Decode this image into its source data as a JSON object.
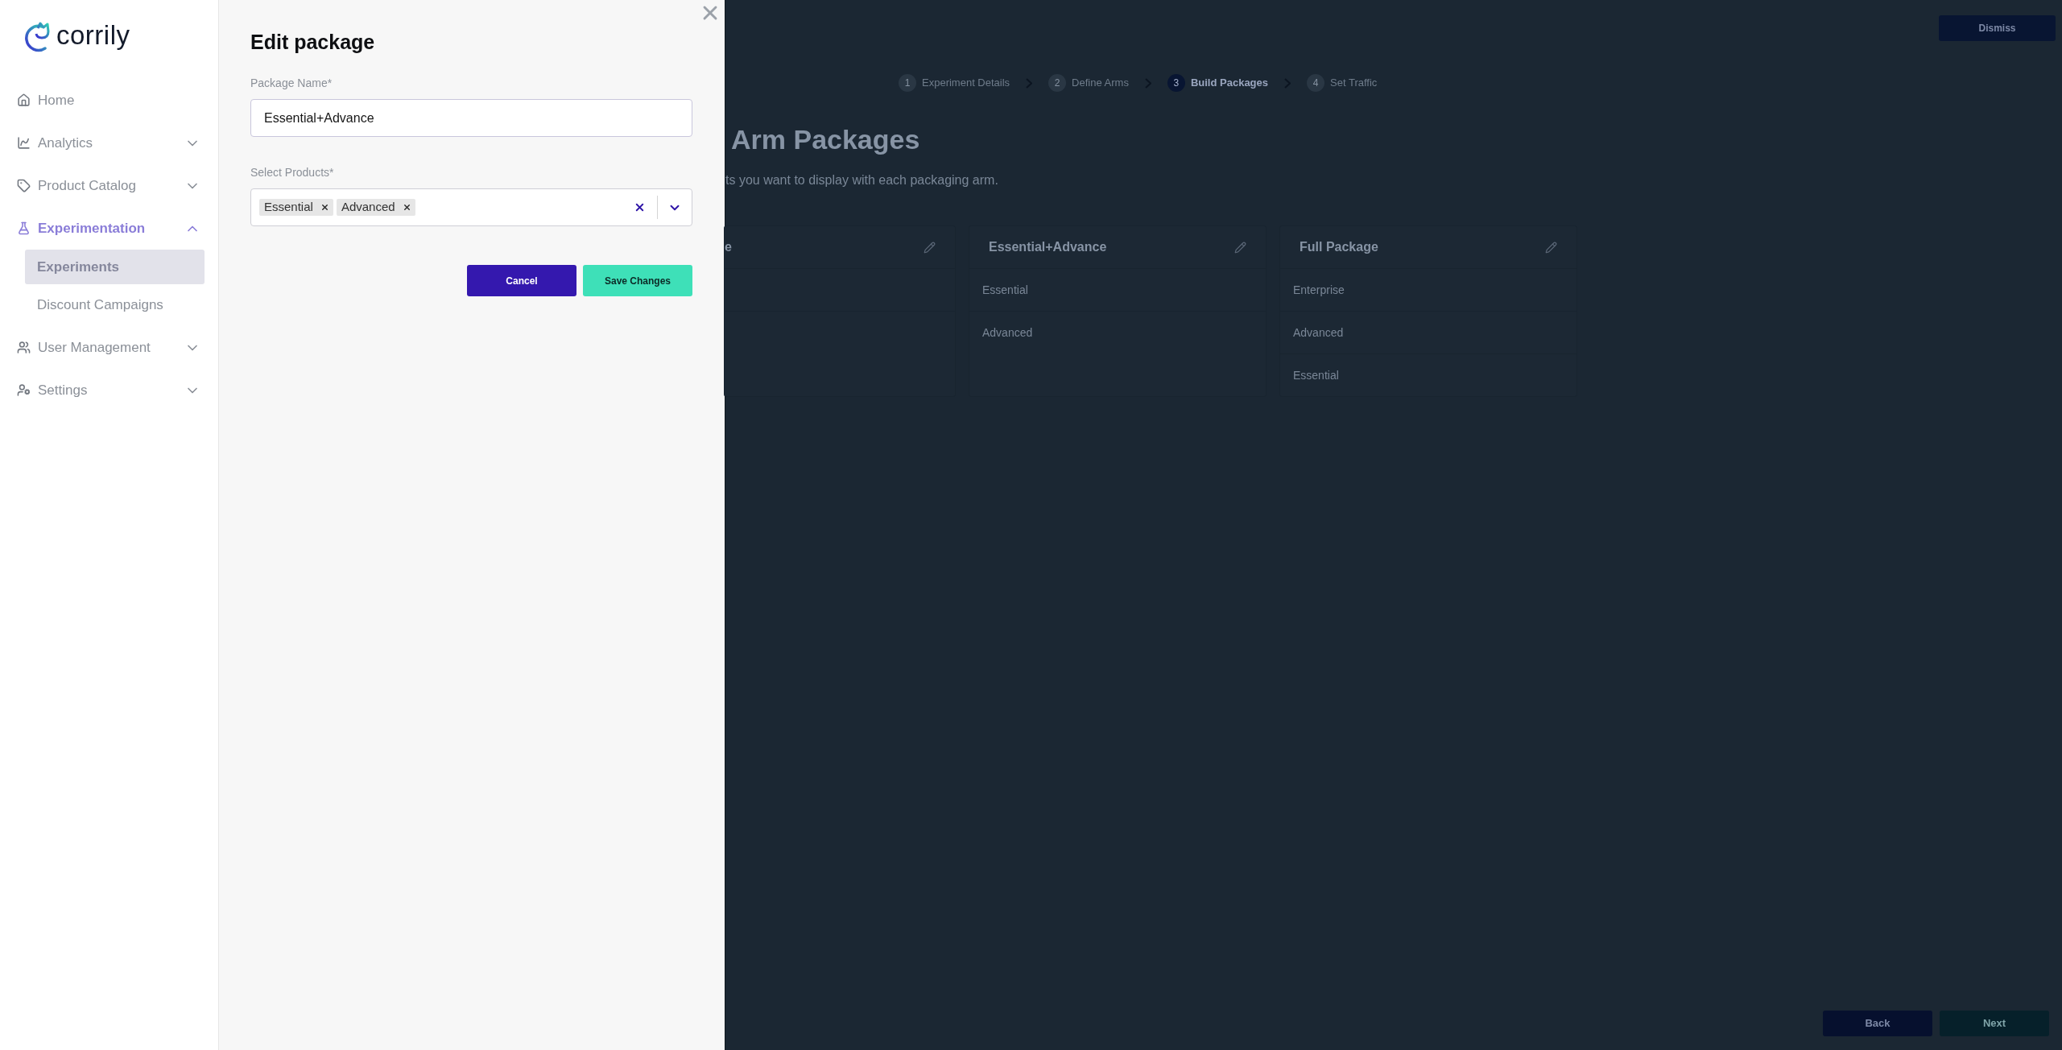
{
  "sidebar": {
    "logo": "corrily",
    "items": [
      {
        "label": "Home",
        "kind": "link",
        "selected": false
      },
      {
        "label": "Analytics",
        "kind": "group",
        "selected": false,
        "expanded": false
      },
      {
        "label": "Product Catalog",
        "kind": "group",
        "selected": false,
        "expanded": false
      },
      {
        "label": "Experimentation",
        "kind": "group",
        "selected": true,
        "expanded": true,
        "children": [
          {
            "label": "Experiments",
            "selected": true
          },
          {
            "label": "Discount Campaigns",
            "selected": false
          }
        ]
      },
      {
        "label": "User Management",
        "kind": "group",
        "selected": false,
        "expanded": false
      },
      {
        "label": "Settings",
        "kind": "group",
        "selected": false,
        "expanded": false
      }
    ]
  },
  "panel": {
    "title": "Edit package",
    "package_name": {
      "label": "Package Name*",
      "value": "Essential+Advance"
    },
    "products": {
      "label": "Select Products*",
      "tags": [
        "Essential",
        "Advanced"
      ]
    },
    "buttons": {
      "cancel": "Cancel",
      "save": "Save Changes"
    }
  },
  "page": {
    "dismiss": "Dismiss",
    "steps": [
      {
        "number": "1",
        "label": "Experiment Details",
        "selected": false
      },
      {
        "number": "2",
        "label": "Define Arms",
        "selected": false
      },
      {
        "number": "3",
        "label": "Build Packages",
        "selected": true
      },
      {
        "number": "4",
        "label": "Set Traffic",
        "selected": false
      }
    ],
    "title": "Arm Packages",
    "subtitle": "ts you want to display with each packaging arm.",
    "packages": [
      {
        "name": "e"
      },
      {
        "name": "Essential+Advance",
        "items": [
          "Essential",
          "Advanced"
        ]
      },
      {
        "name": "Full Package",
        "items": [
          "Enterprise",
          "Advanced",
          "Essential"
        ]
      }
    ],
    "buttons": {
      "back": "Back",
      "next": "Next"
    }
  }
}
